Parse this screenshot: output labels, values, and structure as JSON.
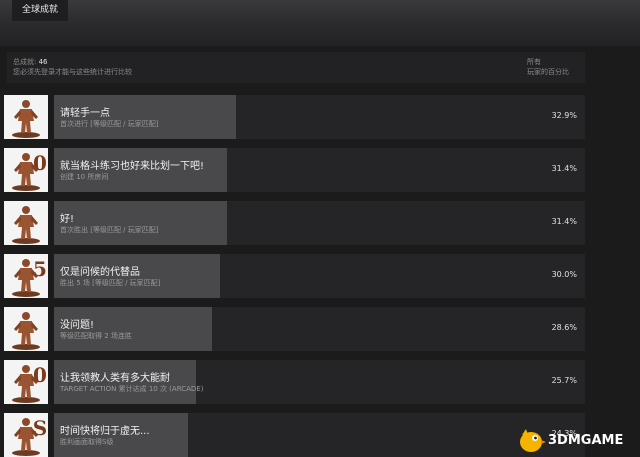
{
  "tab": {
    "label": "全球成就"
  },
  "summary": {
    "total_label": "总成就:",
    "total_value": "46",
    "note": "您必须先登录才能与这些统计进行比较",
    "right_line1": "所有",
    "right_line2": "玩家的百分比"
  },
  "achievements": [
    {
      "title": "请轻手一点",
      "desc": "首次进行 [等级匹配 / 玩家匹配]",
      "percent": "32.9%",
      "value": 32.9,
      "badge": "",
      "icon": "fighter-figure-icon"
    },
    {
      "title": "就当格斗练习也好来比划一下吧!",
      "desc": "创建 10 所房间",
      "percent": "31.4%",
      "value": 31.4,
      "badge": "0",
      "icon": "fighter-figure-icon"
    },
    {
      "title": "好!",
      "desc": "首次胜出 [等级匹配 / 玩家匹配]",
      "percent": "31.4%",
      "value": 31.4,
      "badge": "",
      "icon": "fighter-figure-icon"
    },
    {
      "title": "仅是问候的代替品",
      "desc": "胜出 5 场 [等级匹配 / 玩家匹配]",
      "percent": "30.0%",
      "value": 30.0,
      "badge": "5",
      "icon": "fighter-figure-icon"
    },
    {
      "title": "没问题!",
      "desc": "等级匹配取得 2 场连胜",
      "percent": "28.6%",
      "value": 28.6,
      "badge": "",
      "icon": "fighter-figure-icon"
    },
    {
      "title": "让我领教人类有多大能耐",
      "desc": "TARGET ACTION 累计达成 10 次 (ARCADE)",
      "percent": "25.7%",
      "value": 25.7,
      "badge": "0",
      "icon": "fighter-figure-icon"
    },
    {
      "title": "时间快将归于虚无...",
      "desc": "胜利画面取得S级",
      "percent": "24.3%",
      "value": 24.3,
      "badge": "S",
      "icon": "fighter-figure-icon"
    }
  ],
  "watermark": {
    "text": "3DMGAME",
    "icon": "bird-logo-icon"
  },
  "colors": {
    "bar": "#49494b",
    "row_bg": "#252527",
    "background": "#1b1b1c"
  }
}
